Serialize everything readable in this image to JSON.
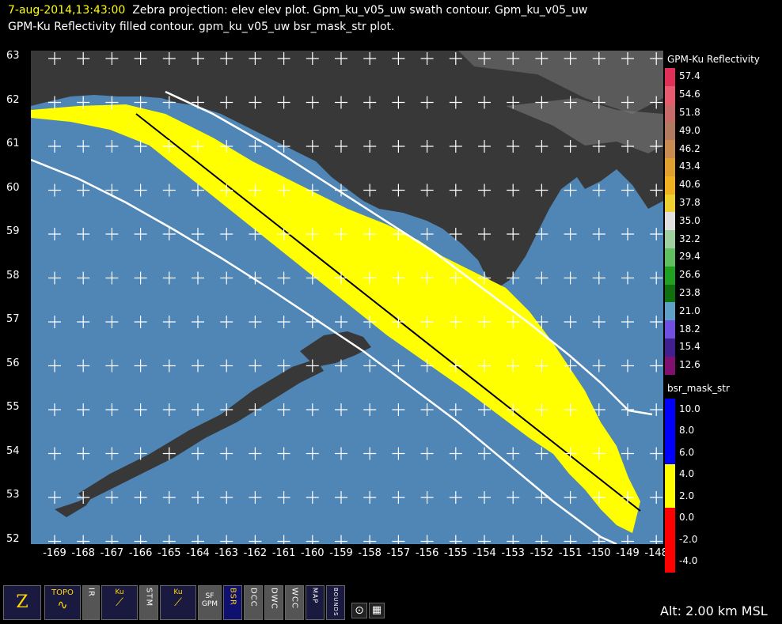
{
  "header": {
    "timestamp": "7-aug-2014,13:43:00",
    "line1_rest": "Zebra projection: elev elev  plot.  Gpm_ku_v05_uw swath contour.  Gpm_ku_v05_uw",
    "line2": "GPM-Ku Reflectivity filled contour.  gpm_ku_v05_uw bsr_mask_str  plot."
  },
  "axes": {
    "y_labels": [
      "63",
      "62",
      "61",
      "60",
      "59",
      "58",
      "57",
      "56",
      "55",
      "54",
      "53",
      "52"
    ],
    "x_labels": [
      "-169",
      "-168",
      "-167",
      "-166",
      "-165",
      "-164",
      "-163",
      "-162",
      "-161",
      "-160",
      "-159",
      "-158",
      "-157",
      "-156",
      "-155",
      "-154",
      "-153",
      "-152",
      "-151",
      "-150",
      "-149",
      "-148"
    ]
  },
  "legend_reflectivity": {
    "title": "GPM-Ku Reflectivity",
    "entries": [
      {
        "label": "57.4",
        "color": "#e0305a"
      },
      {
        "label": "54.6",
        "color": "#e85a70"
      },
      {
        "label": "51.8",
        "color": "#c86a6a"
      },
      {
        "label": "49.0",
        "color": "#b07a60"
      },
      {
        "label": "46.2",
        "color": "#c88c50"
      },
      {
        "label": "43.4",
        "color": "#e0a030"
      },
      {
        "label": "40.6",
        "color": "#f0b020"
      },
      {
        "label": "37.8",
        "color": "#f0d030"
      },
      {
        "label": "35.0",
        "color": "#e0e0e0"
      },
      {
        "label": "32.2",
        "color": "#a0d0a0"
      },
      {
        "label": "29.4",
        "color": "#60c060"
      },
      {
        "label": "26.6",
        "color": "#20a020"
      },
      {
        "label": "23.8",
        "color": "#107010"
      },
      {
        "label": "21.0",
        "color": "#60a0c8"
      },
      {
        "label": "18.2",
        "color": "#7050e0"
      },
      {
        "label": "15.4",
        "color": "#402090"
      },
      {
        "label": "12.6",
        "color": "#801070"
      }
    ]
  },
  "legend_mask": {
    "title": "bsr_mask_str",
    "entries": [
      {
        "label": "10.0",
        "color": "#0000ff"
      },
      {
        "label": "8.0",
        "color": "#0000ff"
      },
      {
        "label": "6.0",
        "color": "#0000ff"
      },
      {
        "label": "4.0",
        "color": "#ffff00"
      },
      {
        "label": "2.0",
        "color": "#ffff00"
      },
      {
        "label": "0.0",
        "color": "#ff0000"
      },
      {
        "label": "-2.0",
        "color": "#ff0000"
      },
      {
        "label": "-4.0",
        "color": "#ff0000"
      }
    ]
  },
  "toolbar": {
    "zebra": "Z",
    "topo": "TOPO",
    "ir": "IR",
    "ku": "Ku",
    "stm": "STM",
    "ku_v5": "Ku",
    "sfgpm": "SF GPM",
    "bsr": "BSR",
    "dcc": "DCC",
    "dwc": "DWC",
    "wcc": "WCC",
    "map": "MAP",
    "bounds": "BOUNDS"
  },
  "status": {
    "altitude": "Alt: 2.00 km MSL"
  },
  "colors": {
    "ocean": "#4f86b5",
    "land_dark": "#383838",
    "precip": "#ffff00",
    "swath_edge": "#ffffff",
    "nadir": "#000000"
  }
}
